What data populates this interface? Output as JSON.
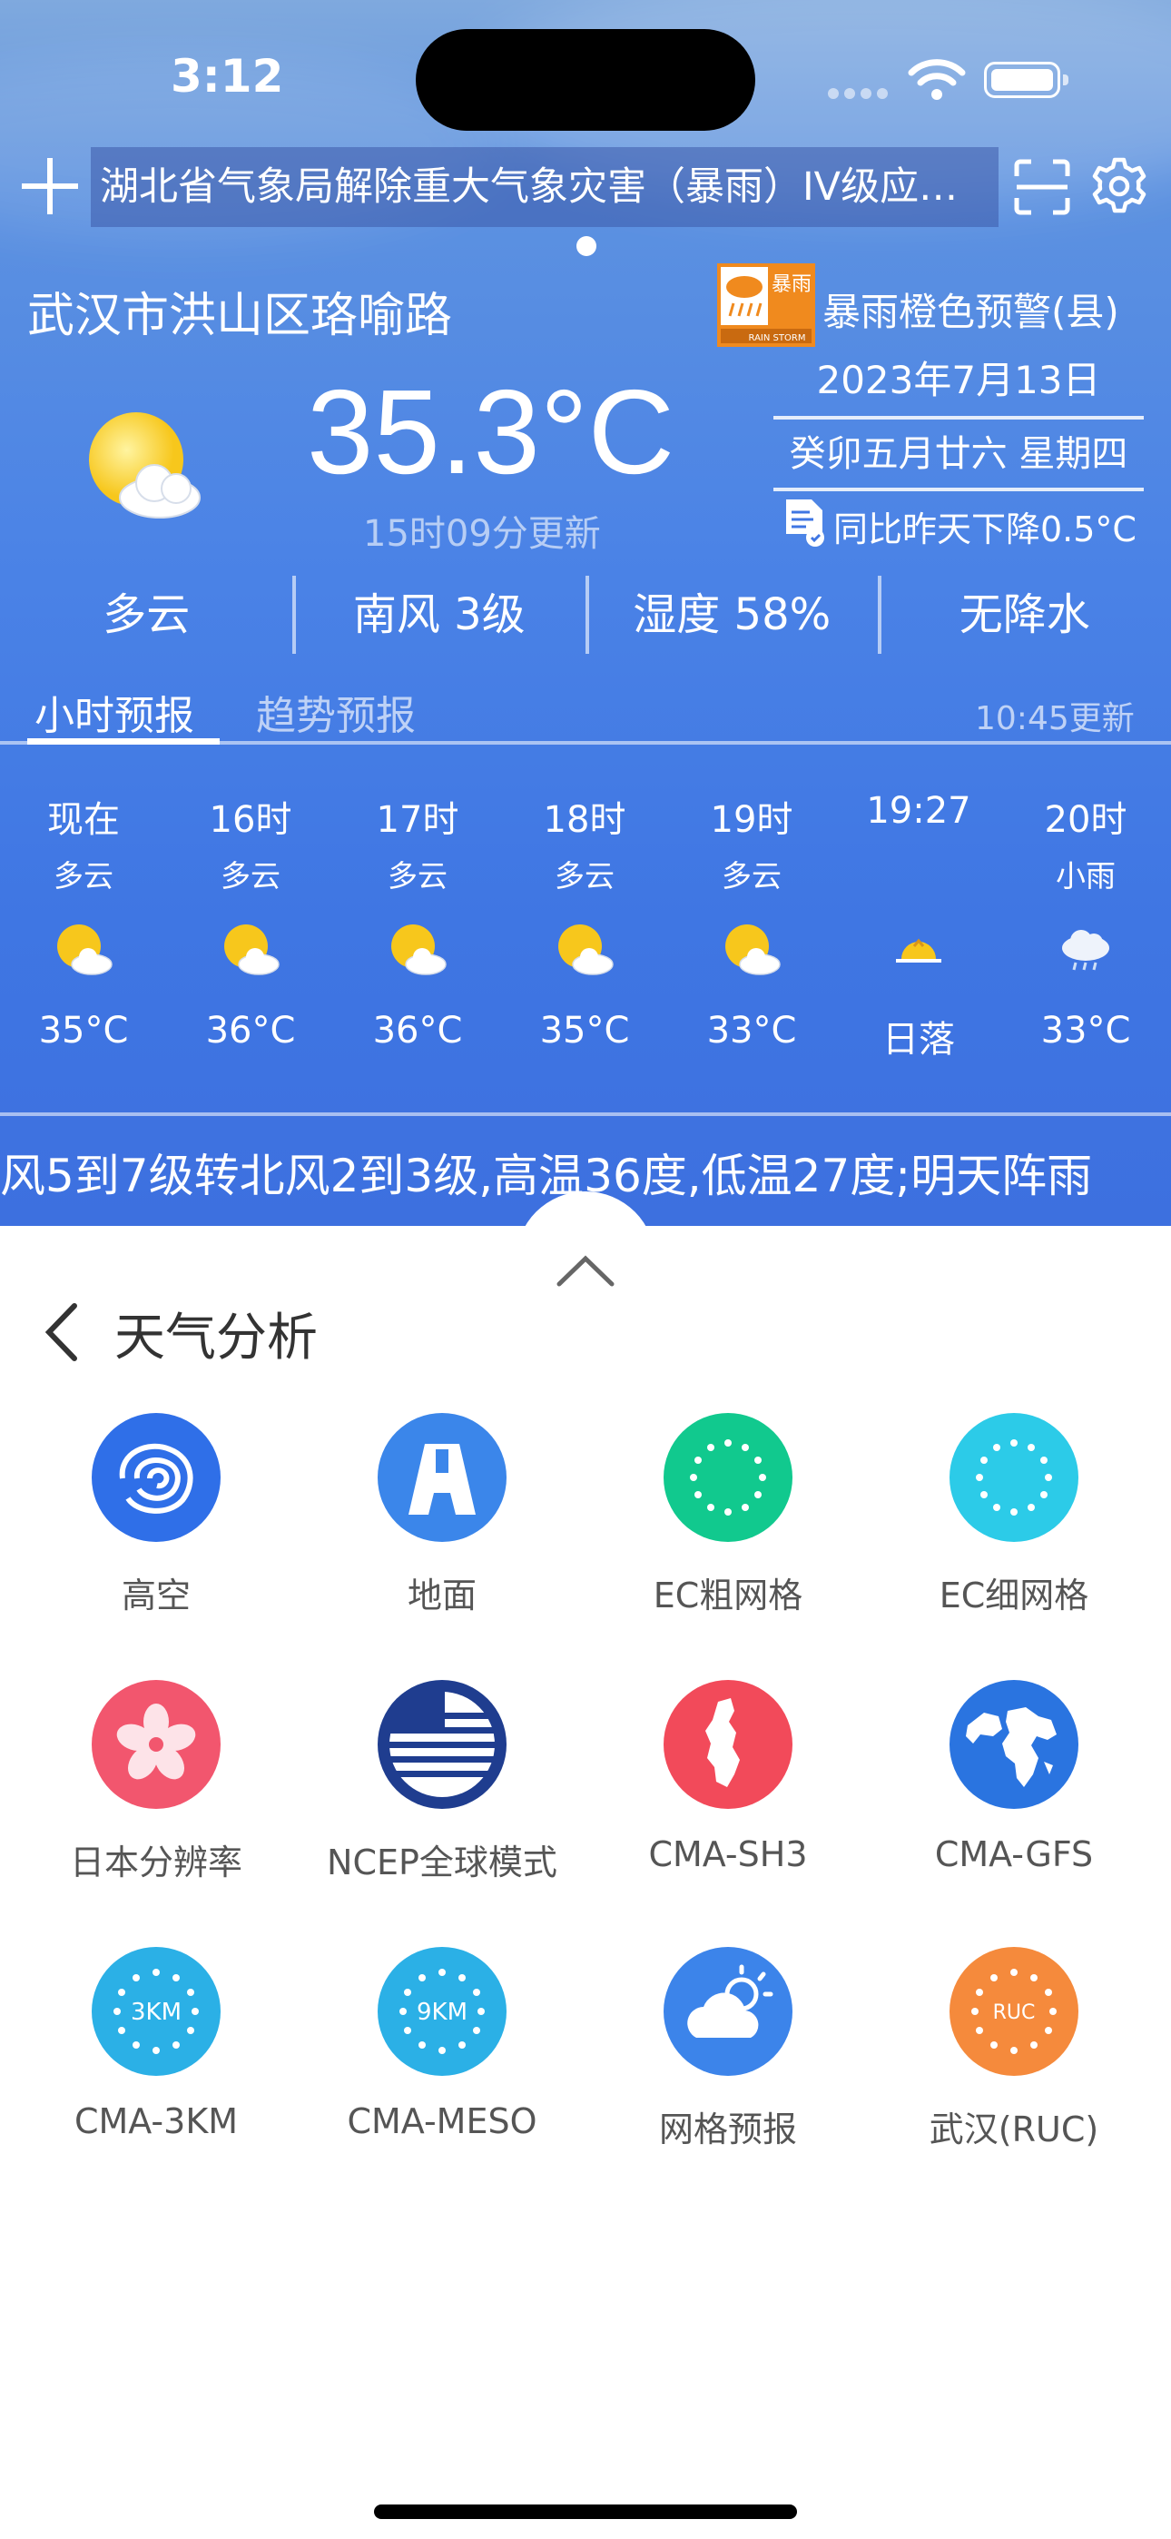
{
  "status": {
    "time": "3:12"
  },
  "header": {
    "alert_banner": "湖北省气象局解除重大气象灾害（暴雨）IV级应急响应",
    "location": "武汉市洪山区珞喻路",
    "warning_badge_text": "暴雨",
    "warning_badge_sub": "RAIN STORM",
    "warning_text": "暴雨橙色预警(县)"
  },
  "current": {
    "date": "2023年7月13日",
    "lunar": "癸卯五月廿六 星期四",
    "compare": "同比昨天下降0.5°C",
    "temperature": "35.3°C",
    "update_time": "15时09分更新",
    "conditions": [
      "多云",
      "南风 3级",
      "湿度 58%",
      "无降水"
    ]
  },
  "forecast_tabs": {
    "hourly": "小时预报",
    "trend": "趋势预报",
    "updated": "10:45更新"
  },
  "hourly": [
    {
      "time": "现在",
      "cond": "多云",
      "icon": "partly-cloudy-icon",
      "temp": "35°C"
    },
    {
      "time": "16时",
      "cond": "多云",
      "icon": "partly-cloudy-icon",
      "temp": "36°C"
    },
    {
      "time": "17时",
      "cond": "多云",
      "icon": "partly-cloudy-icon",
      "temp": "36°C"
    },
    {
      "time": "18时",
      "cond": "多云",
      "icon": "partly-cloudy-icon",
      "temp": "35°C"
    },
    {
      "time": "19时",
      "cond": "多云",
      "icon": "partly-cloudy-icon",
      "temp": "33°C"
    },
    {
      "time": "19:27",
      "cond": "",
      "icon": "sunset-icon",
      "temp": "日落"
    },
    {
      "time": "20时",
      "cond": "小雨",
      "icon": "light-rain-icon",
      "temp": "33°C"
    }
  ],
  "ticker": "风5到7级转北风2到3级,高温36度,低温27度;明天阵雨",
  "analysis": {
    "title": "天气分析",
    "items": [
      {
        "label": "高空",
        "icon": "upper-air-contour-icon",
        "color": "#2f6fe8"
      },
      {
        "label": "地面",
        "icon": "road-icon",
        "color": "#3b86ea"
      },
      {
        "label": "EC粗网格",
        "icon": "eu-stars-icon",
        "color": "#11c98e"
      },
      {
        "label": "EC细网格",
        "icon": "eu-stars-icon",
        "color": "#2ccbe8"
      },
      {
        "label": "日本分辨率",
        "icon": "sakura-icon",
        "color": "#f2566e"
      },
      {
        "label": "NCEP全球模式",
        "icon": "us-flag-icon",
        "color": "#1f3d8f"
      },
      {
        "label": "CMA-SH3",
        "icon": "shanghai-map-icon",
        "color": "#f24a5a"
      },
      {
        "label": "CMA-GFS",
        "icon": "globe-icon",
        "color": "#2a74e0"
      },
      {
        "label": "CMA-3KM",
        "icon": "stars-badge-icon",
        "badge": "3KM",
        "color": "#2bb0e6"
      },
      {
        "label": "CMA-MESO",
        "icon": "stars-badge-icon",
        "badge": "9KM",
        "color": "#2bb0e6"
      },
      {
        "label": "网格预报",
        "icon": "cloud-sun-icon",
        "color": "#3c84ea"
      },
      {
        "label": "武汉(RUC)",
        "icon": "stars-badge-icon",
        "badge": "RUC",
        "color": "#f58a3c"
      }
    ]
  }
}
